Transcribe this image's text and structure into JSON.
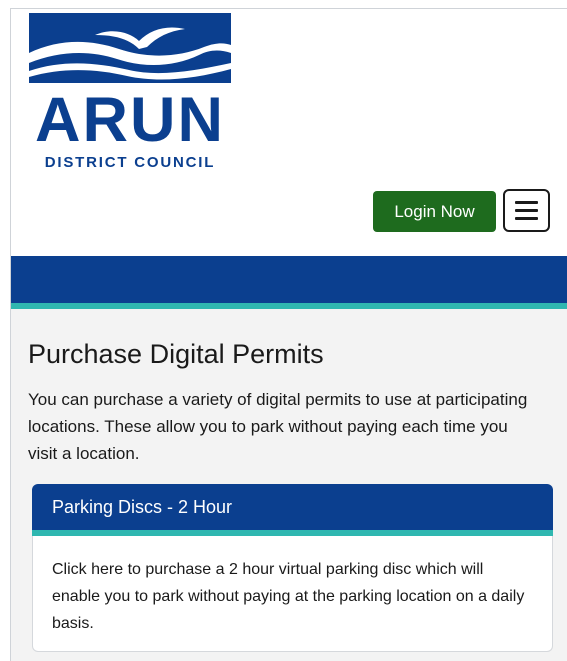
{
  "logo": {
    "wordmark": "ARUN",
    "subtitle": "DISTRICT COUNCIL",
    "brand_color": "#0b3f8f"
  },
  "header": {
    "login_label": "Login Now",
    "login_color": "#1e6b1e",
    "menu_icon": "hamburger-menu-icon"
  },
  "nav": {
    "band_color": "#0b3f8f",
    "accent_color": "#2fb7b0"
  },
  "main": {
    "title": "Purchase Digital Permits",
    "intro": "You can purchase a variety of digital permits to use at participating locations. These allow you to park without paying each time you visit a location.",
    "cards": [
      {
        "heading": "Parking Discs - 2 Hour",
        "body": "Click here to purchase a 2 hour virtual parking disc which will enable you to park without paying at the parking location on a daily basis."
      }
    ]
  }
}
